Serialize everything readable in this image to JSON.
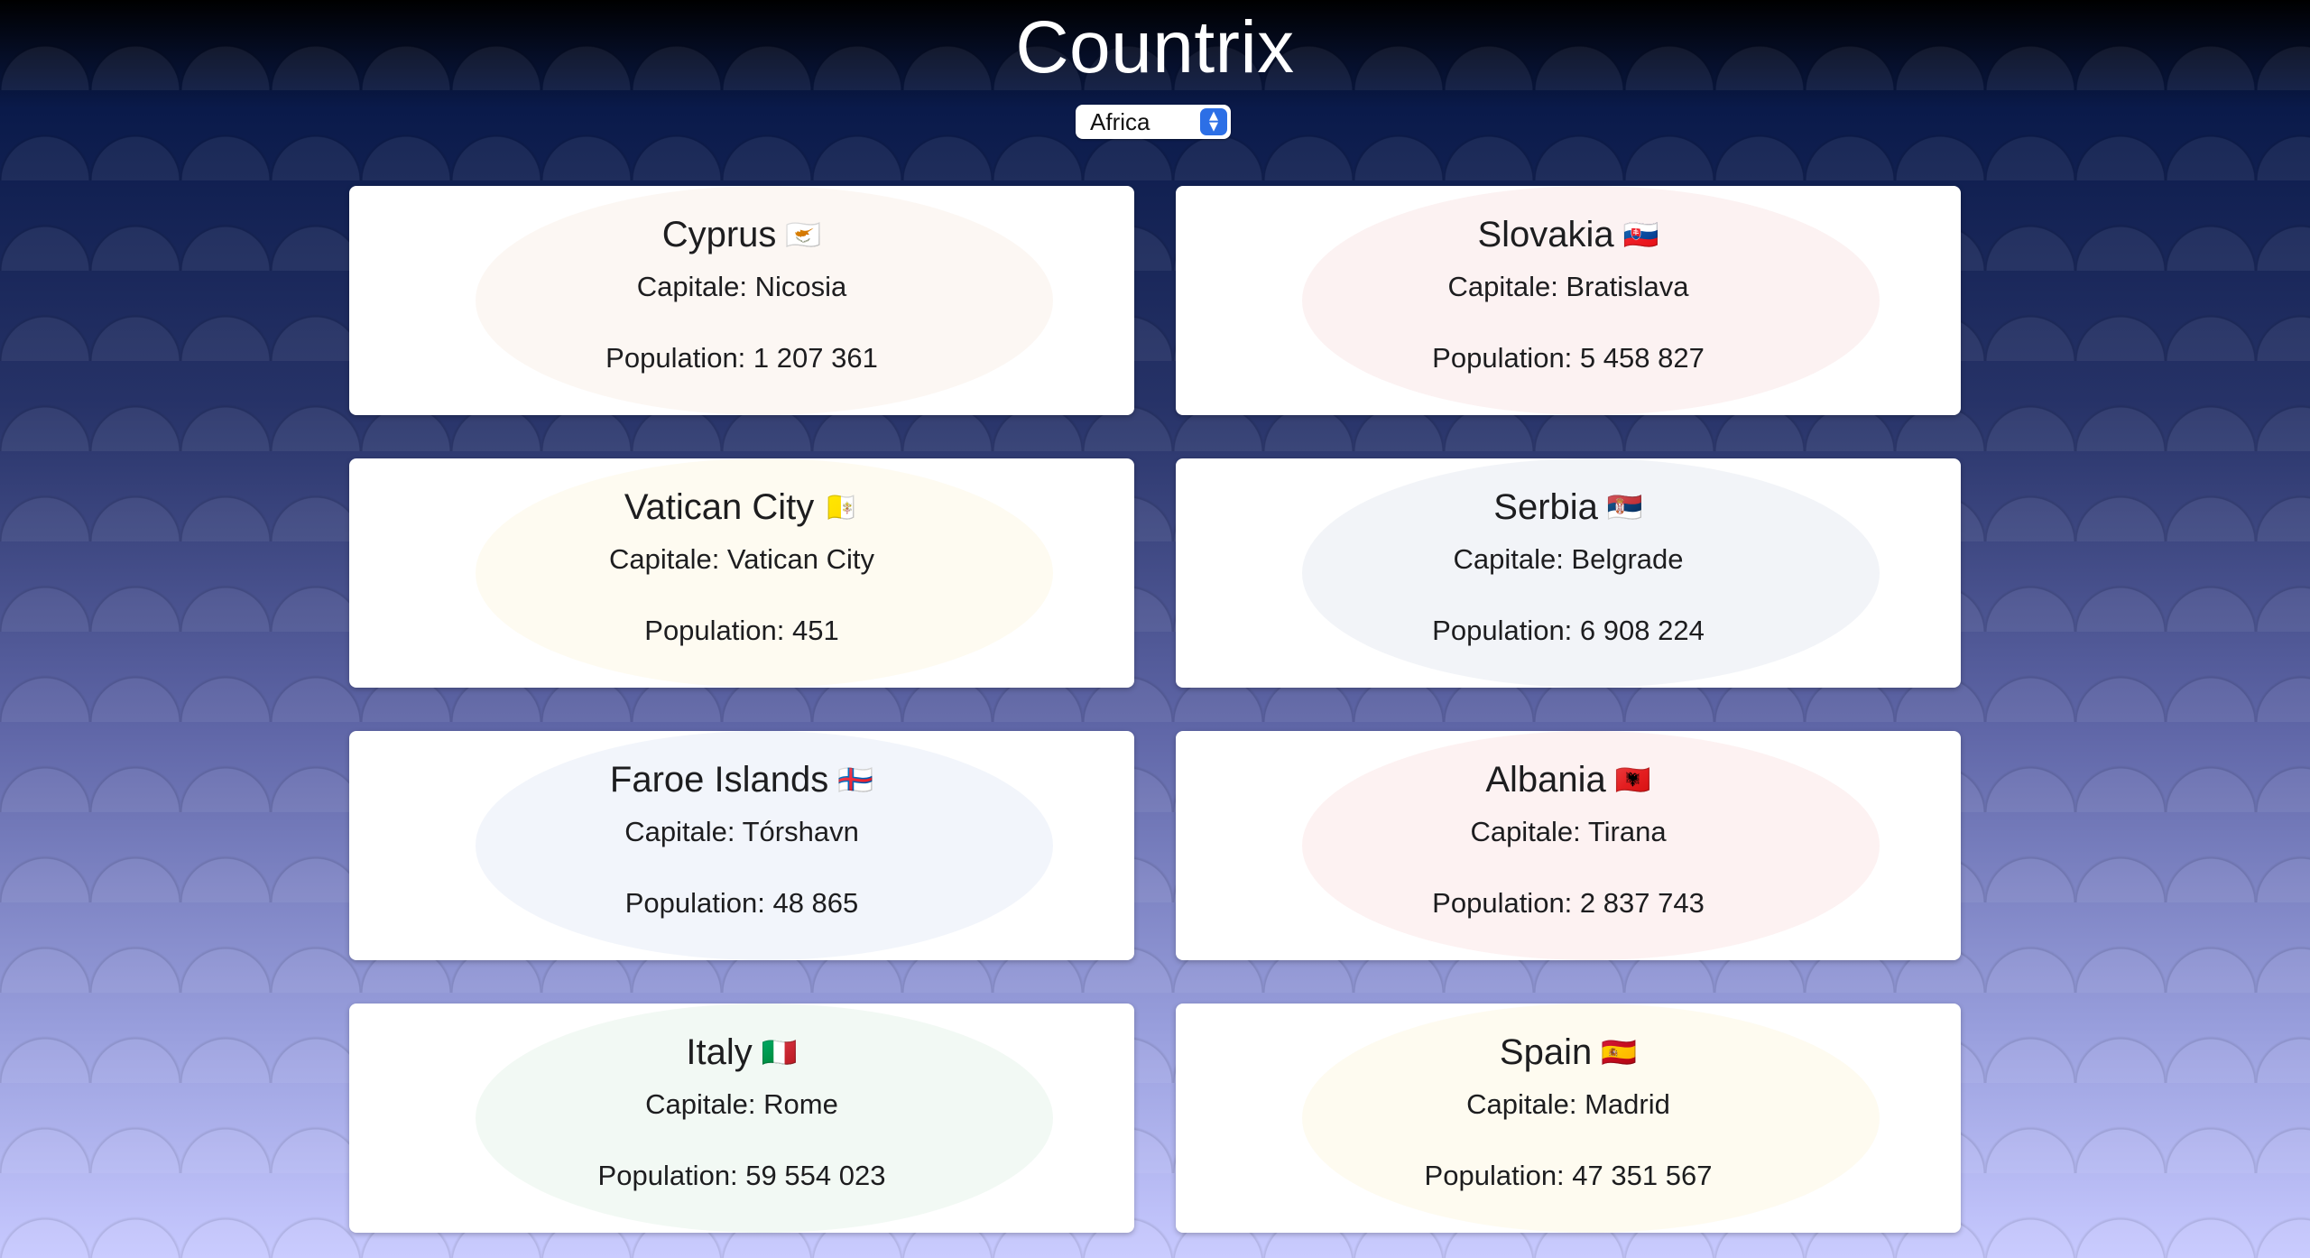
{
  "app": {
    "title": "Countrix"
  },
  "filter": {
    "region_selected": "Africa"
  },
  "cards": [
    {
      "name": "Cyprus",
      "flag": "🇨🇾",
      "capital": "Capitale: Nicosia",
      "population": "Population: 1 207 361",
      "tint": "#c8793a"
    },
    {
      "name": "Slovakia",
      "flag": "🇸🇰",
      "capital": "Capitale: Bratislava",
      "population": "Population: 5 458 827",
      "tint": "#d11a2a"
    },
    {
      "name": "Vatican City",
      "flag": "🇻🇦",
      "capital": "Capitale: Vatican City",
      "population": "Population: 451",
      "tint": "#e8c30b"
    },
    {
      "name": "Serbia",
      "flag": "🇷🇸",
      "capital": "Capitale: Belgrade",
      "population": "Population: 6 908 224",
      "tint": "#1f3f8a"
    },
    {
      "name": "Faroe Islands",
      "flag": "🇫🇴",
      "capital": "Capitale: Tórshavn",
      "population": "Population: 48 865",
      "tint": "#1a57b8"
    },
    {
      "name": "Albania",
      "flag": "🇦🇱",
      "capital": "Capitale: Tirana",
      "population": "Population: 2 837 743",
      "tint": "#e41e20"
    },
    {
      "name": "Italy",
      "flag": "🇮🇹",
      "capital": "Capitale: Rome",
      "population": "Population: 59 554 023",
      "tint": "#2a9a45"
    },
    {
      "name": "Spain",
      "flag": "🇪🇸",
      "capital": "Capitale: Madrid",
      "population": "Population: 47 351 567",
      "tint": "#f1bf00"
    }
  ]
}
